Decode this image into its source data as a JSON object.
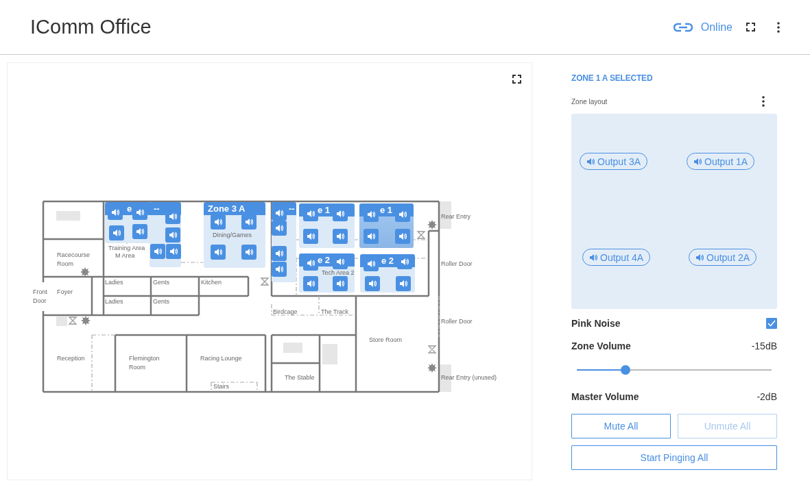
{
  "header": {
    "title": "IComm Office",
    "status": "Online"
  },
  "floorplan": {
    "zones": [
      {
        "title": "e",
        "selected": false
      },
      {
        "title": "--",
        "selected": false
      },
      {
        "title": "Zone 3 A",
        "selected": false
      },
      {
        "title": "--",
        "selected": false
      },
      {
        "title": "e 1",
        "selected": false
      },
      {
        "title": "e 1",
        "selected": true
      },
      {
        "title": "e 2",
        "selected": false
      },
      {
        "title": "e 2",
        "selected": false
      }
    ],
    "rooms": [
      {
        "lines": [
          "Racecourse",
          "Room"
        ]
      },
      {
        "lines": [
          "Training Area"
        ]
      },
      {
        "lines": [
          "M Area"
        ]
      },
      {
        "lines": [
          "Dining/Games"
        ]
      },
      {
        "lines": [
          "Tech Area 2"
        ]
      },
      {
        "lines": [
          "Ladies"
        ]
      },
      {
        "lines": [
          "Gents"
        ]
      },
      {
        "lines": [
          "Kitchen"
        ]
      },
      {
        "lines": [
          "Ladies"
        ]
      },
      {
        "lines": [
          "Gents"
        ]
      },
      {
        "lines": [
          "Foyer"
        ]
      },
      {
        "lines": [
          "Front",
          "Door"
        ]
      },
      {
        "lines": [
          "Birdcage"
        ]
      },
      {
        "lines": [
          "The Track"
        ]
      },
      {
        "lines": [
          "Rear Entry"
        ]
      },
      {
        "lines": [
          "Roller Door"
        ]
      },
      {
        "lines": [
          "Roller Door"
        ]
      },
      {
        "lines": [
          "Rear Entry (unused)"
        ]
      },
      {
        "lines": [
          "Reception"
        ]
      },
      {
        "lines": [
          "Flemington",
          "Room"
        ]
      },
      {
        "lines": [
          "Racing Lounge"
        ]
      },
      {
        "lines": [
          "Stairs"
        ]
      },
      {
        "lines": [
          "The Stable"
        ]
      },
      {
        "lines": [
          "Store Room"
        ]
      }
    ]
  },
  "panel": {
    "heading": "ZONE 1 A SELECTED",
    "layout_label": "Zone layout",
    "outputs": [
      "Output 3A",
      "Output 1A",
      "Output 4A",
      "Output 2A"
    ],
    "pink_noise": {
      "label": "Pink Noise",
      "checked": true
    },
    "zone_volume": {
      "label": "Zone Volume",
      "reading": "-15dB",
      "level": 0.25
    },
    "master_volume": {
      "label": "Master Volume",
      "reading": "-2dB"
    },
    "buttons": [
      {
        "label": "Mute All",
        "disabled": false
      },
      {
        "label": "Unmute All",
        "disabled": true
      },
      {
        "label": "Start Pinging All",
        "disabled": false
      }
    ]
  }
}
